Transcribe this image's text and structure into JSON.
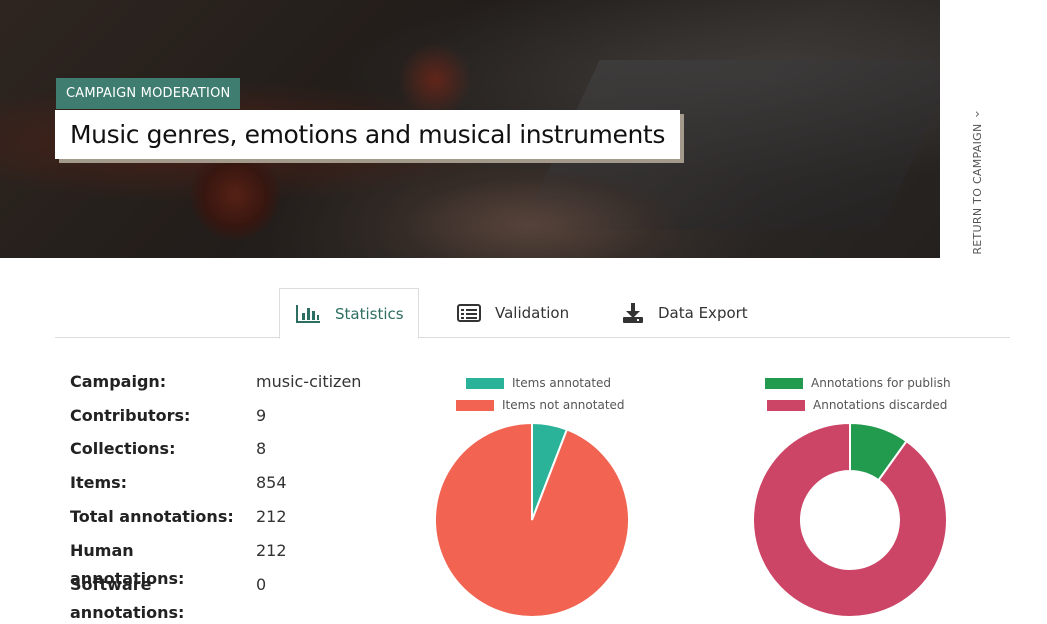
{
  "hero": {
    "tag": "CAMPAIGN MODERATION",
    "title": "Music genres, emotions and musical instruments",
    "return_link": "RETURN TO CAMPAIGN"
  },
  "tabs": [
    {
      "label": "Statistics",
      "icon": "bar-chart-icon",
      "active": true
    },
    {
      "label": "Validation",
      "icon": "list-icon",
      "active": false
    },
    {
      "label": "Data Export",
      "icon": "download-icon",
      "active": false
    }
  ],
  "stats": [
    {
      "label": "Campaign:",
      "value": "music-citizen"
    },
    {
      "label": "Contributors:",
      "value": "9"
    },
    {
      "label": "Collections:",
      "value": "8"
    },
    {
      "label": "Items:",
      "value": "854"
    },
    {
      "label": "Total annotations:",
      "value": "212"
    },
    {
      "label": "Human annotations:",
      "value": "212"
    },
    {
      "label": "Software annotations:",
      "value": "0"
    }
  ],
  "colors": {
    "accent": "#3f7d70",
    "items_annotated": "#2bb39a",
    "items_not_annotated": "#f26351",
    "annotations_publish": "#239b4e",
    "annotations_discarded": "#cc4466"
  },
  "chart_data": [
    {
      "type": "pie",
      "labels": [
        "Items annotated",
        "Items not annotated"
      ],
      "values": [
        50,
        804
      ],
      "colors": [
        "#2bb39a",
        "#f26351"
      ],
      "legend": "top"
    },
    {
      "type": "pie",
      "variant": "doughnut",
      "labels": [
        "Annotations for publish",
        "Annotations discarded"
      ],
      "values": [
        21,
        191
      ],
      "colors": [
        "#239b4e",
        "#cc4466"
      ],
      "legend": "top"
    }
  ]
}
